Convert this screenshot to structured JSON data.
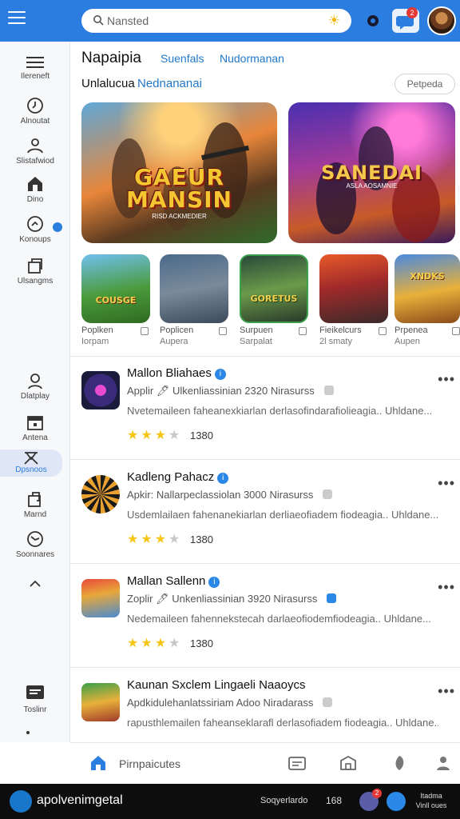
{
  "topbar": {
    "search_placeholder": "Nansted",
    "chat_badge": "2"
  },
  "sidebar": {
    "items": [
      {
        "label": "Ilereneft",
        "icon": "menu-icon"
      },
      {
        "label": "Alnoutat",
        "icon": "clock-icon"
      },
      {
        "label": "Slistafwiod",
        "icon": "person-icon"
      },
      {
        "label": "Dino",
        "icon": "home-icon"
      },
      {
        "label": "Konoups",
        "icon": "gauge-icon"
      },
      {
        "label": "Ulsangms",
        "icon": "box-icon"
      },
      {
        "label": "Dlatplay",
        "icon": "user-icon"
      },
      {
        "label": "Antena",
        "icon": "calendar-icon"
      },
      {
        "label": "Dpsnoos",
        "icon": "easel-icon"
      },
      {
        "label": "Marnd",
        "icon": "bag-icon"
      },
      {
        "label": "Soonnares",
        "icon": "compass-icon"
      },
      {
        "label": "Toslinr",
        "icon": "chat-icon"
      }
    ]
  },
  "header": {
    "title": "Napaipia",
    "tab1": "Suenfals",
    "tab2": "Nudormanan",
    "sub_a": "Unlalucua",
    "sub_b": "Nednananai",
    "pill": "Petpeda"
  },
  "banners": [
    {
      "title": "GAEUR\nMANSIN",
      "tagline": "RISD ACKMEDIER"
    },
    {
      "title": "SANEDAI",
      "tagline": "ASLA AOSAMNIE"
    }
  ],
  "thumbs": [
    {
      "art": "COUSGE",
      "l1": "Poplken",
      "l2": "Iorpam"
    },
    {
      "art": "",
      "l1": "Poplicen",
      "l2": "Aupera"
    },
    {
      "art": "GORETUS",
      "l1": "Surpuen",
      "l2": "Sarpalat"
    },
    {
      "art": "",
      "l1": "Fieikelcurs",
      "l2": "2l smaty"
    },
    {
      "art": "XNDKS",
      "l1": "Prpenea",
      "l2": "Aupen"
    }
  ],
  "apps": [
    {
      "name": "Mallon Bliahaes",
      "meta": "Applir 🖊 Ulkenliassinian 2320 Nirasurss",
      "desc": "Nvetemaileen faheanexkiarlan derlasofindarafiolieagia.. Uhldane...",
      "rating": 3,
      "count": "1380"
    },
    {
      "name": "Kadleng Pahacz",
      "meta": "Apkir: Nallarpeclassiolan 3000 Nirasurss",
      "desc": "Usdemlailaen fahenanekiarlan derliaeofiadem fiodeagia.. Uhldane...",
      "rating": 3,
      "count": "1380"
    },
    {
      "name": "Mallan Sallenn",
      "meta": "Zoplir 🖊 Unkenliassinian 3920 Nirasurss",
      "desc": "Nedemaileen fahennekstecah darlaeofiodemfiodeagia.. Uhldane...",
      "rating": 3,
      "count": "1380"
    },
    {
      "name": "Kaunan Sxclem Lingaeli Naaoycs",
      "meta": "Apdkidulehanlatssiriam Adoo Niradarass",
      "desc": "rapusthlemailen faheanseklarafl derlasofiadem fiodeagia.. Uhldane...",
      "rating": 3,
      "count": "1380"
    }
  ],
  "bottomnav": {
    "home_label": "Pirnpaicutes"
  },
  "taskbar": {
    "app_name": "apolvenimgetal",
    "status": "Soqyerlardo",
    "num": "168",
    "badge": "2",
    "clock_l1": "Itadma",
    "clock_l2": "Vinll oues"
  },
  "colors": {
    "accent": "#2b7de0",
    "star": "#f5c518"
  }
}
